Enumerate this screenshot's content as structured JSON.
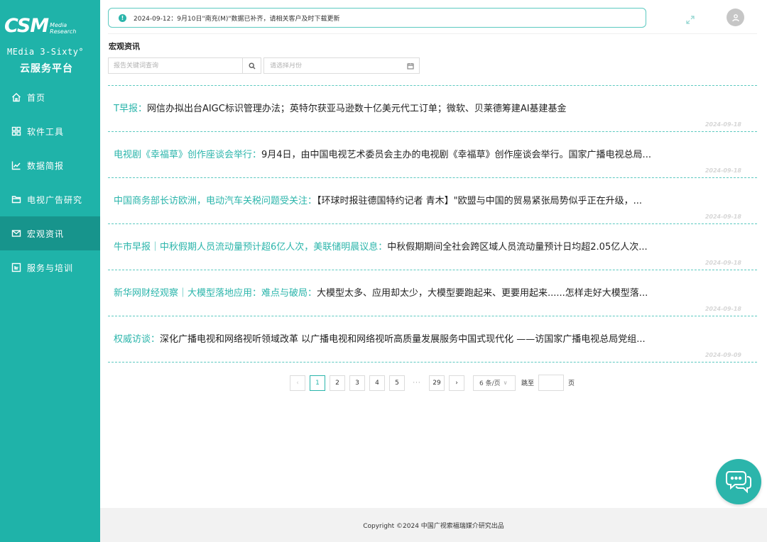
{
  "brand": {
    "logo_text": "CSM",
    "logo_sub1": "Media",
    "logo_sub2": "Research",
    "name_en": "MEdia 3-Sixty°",
    "name_cn": "云服务平台"
  },
  "sidebar": {
    "items": [
      {
        "label": "首页",
        "icon": "home-icon",
        "active": false
      },
      {
        "label": "软件工具",
        "icon": "grid-icon",
        "active": false
      },
      {
        "label": "数据简报",
        "icon": "line-chart-icon",
        "active": false
      },
      {
        "label": "电视广告研究",
        "icon": "folder-icon",
        "active": false
      },
      {
        "label": "宏观资讯",
        "icon": "mail-icon",
        "active": true
      },
      {
        "label": "服务与培训",
        "icon": "box-arrow-icon",
        "active": false
      }
    ]
  },
  "notice": {
    "text": "2024-09-12：9月10日\"南充(M)\"数据已补齐，请相关客户及时下载更新"
  },
  "page": {
    "title": "宏观资讯"
  },
  "search": {
    "placeholder": "报告关键词查询",
    "month_placeholder": "请选择月份"
  },
  "news": [
    {
      "head": "T早报：",
      "body": "网信办拟出台AIGC标识管理办法；英特尔获亚马逊数十亿美元代工订单；微软、贝莱德筹建AI基建基金",
      "date": "2024-09-18"
    },
    {
      "head": "电视剧《幸福草》创作座谈会举行：",
      "body": "9月4日，由中国电视艺术委员会主办的电视剧《幸福草》创作座谈会举行。国家广播电视总局...",
      "date": "2024-09-18"
    },
    {
      "head": "中国商务部长访欧洲，电动汽车关税问题受关注：",
      "body": "【环球时报驻德国特约记者 青木】\"欧盟与中国的贸易紧张局势似乎正在升级，...",
      "date": "2024-09-18"
    },
    {
      "head": "牛市早报｜中秋假期人员流动量预计超6亿人次，美联储明晨议息：",
      "body": "中秋假期期间全社会跨区域人员流动量预计日均超2.05亿人次...",
      "date": "2024-09-18"
    },
    {
      "head": "新华网财经观察｜大模型落地应用：难点与破局：",
      "body": "大模型太多、应用却太少，大模型要跑起来、更要用起来......怎样走好大模型落...",
      "date": "2024-09-18"
    },
    {
      "head": "权威访谈：",
      "body": "深化广播电视和网络视听领域改革 以广播电视和网络视听高质量发展服务中国式现代化 ——访国家广播电视总局党组...",
      "date": "2024-09-09"
    }
  ],
  "pagination": {
    "prev": "‹",
    "next": "›",
    "pages": [
      "1",
      "2",
      "3",
      "4",
      "5"
    ],
    "ellipsis": "···",
    "last": "29",
    "current": "1",
    "page_size": "6 条/页",
    "jump_label": "跳至",
    "jump_unit": "页"
  },
  "footer": {
    "copyright": "Copyright ©2024 中国广视索福瑞媒介研究出品"
  },
  "colors": {
    "accent": "#1fb3a9",
    "accent_dark": "#17948c",
    "link": "#2bb5ab"
  }
}
